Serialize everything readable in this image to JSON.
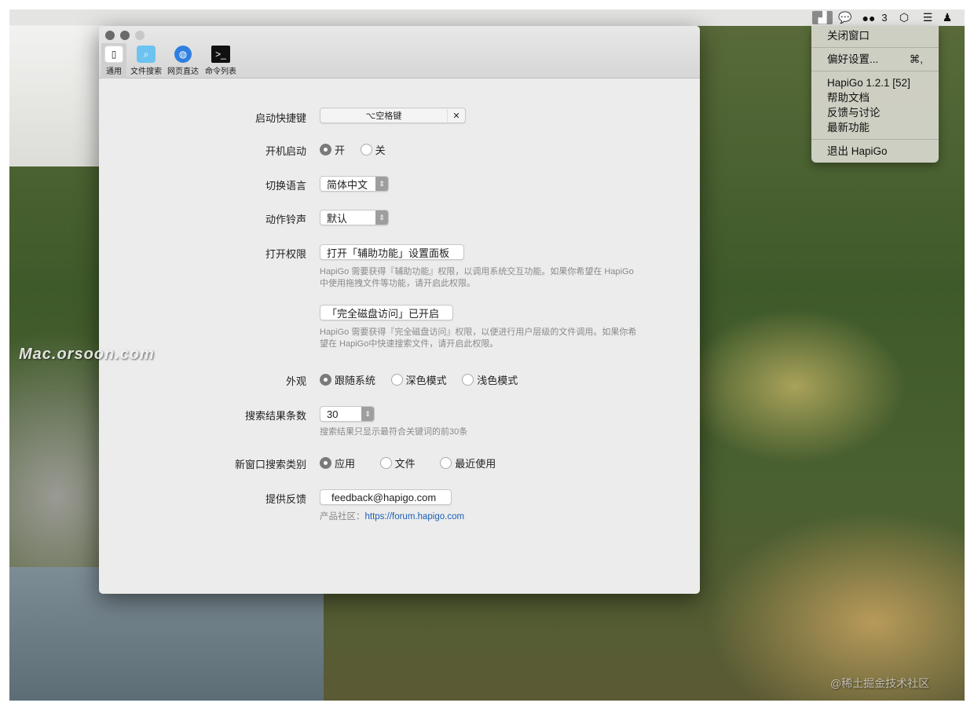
{
  "menubar": {
    "wechat_badge": "3",
    "icons": [
      "hapigo-icon",
      "chat-icon",
      "wechat-icon",
      "hexagon-icon",
      "stack-icon",
      "qq-icon"
    ]
  },
  "dropdown": {
    "items": [
      {
        "label": "关闭窗口"
      },
      {
        "label": "偏好设置...",
        "shortcut": "⌘,"
      },
      {
        "label": "HapiGo 1.2.1 [52]"
      },
      {
        "label": "帮助文档"
      },
      {
        "label": "反馈与讨论"
      },
      {
        "label": "最新功能"
      },
      {
        "label": "退出 HapiGo"
      }
    ]
  },
  "window": {
    "tabs": [
      {
        "label": "通用",
        "icon": "phone-icon"
      },
      {
        "label": "文件搜索",
        "icon": "search-folder-icon"
      },
      {
        "label": "网页直达",
        "icon": "globe-icon"
      },
      {
        "label": "命令列表",
        "icon": "terminal-icon"
      }
    ],
    "form": {
      "hotkey": {
        "label": "启动快捷键",
        "value": "⌥空格键",
        "clear": "✕"
      },
      "autostart": {
        "label": "开机启动",
        "options": [
          "开",
          "关"
        ],
        "selected": 0
      },
      "language": {
        "label": "切换语言",
        "value": "简体中文"
      },
      "sound": {
        "label": "动作铃声",
        "value": "默认"
      },
      "permission": {
        "label": "打开权限",
        "button1": "打开「辅助功能」设置面板",
        "help1": "HapiGo 需要获得『辅助功能』权限，以调用系统交互功能。如果你希望在 HapiGo中使用拖拽文件等功能，请开启此权限。",
        "button2": "「完全磁盘访问」已开启",
        "help2": "HapiGo 需要获得『完全磁盘访问』权限，以便进行用户层级的文件调用。如果你希望在 HapiGo中快速搜索文件，请开启此权限。"
      },
      "appearance": {
        "label": "外观",
        "options": [
          "跟随系统",
          "深色模式",
          "浅色模式"
        ],
        "selected": 0
      },
      "result_count": {
        "label": "搜索结果条数",
        "value": "30",
        "help": "搜索结果只显示最符合关键词的前30条"
      },
      "new_window_category": {
        "label": "新窗口搜索类别",
        "options": [
          "应用",
          "文件",
          "最近使用"
        ],
        "selected": 0
      },
      "feedback": {
        "label": "提供反馈",
        "value": "feedback@hapigo.com",
        "community_label": "产品社区：",
        "community_link": "https://forum.hapigo.com"
      }
    }
  },
  "watermarks": {
    "left": "Mac.orsoon.com",
    "right": "@稀土掘金技术社区"
  }
}
